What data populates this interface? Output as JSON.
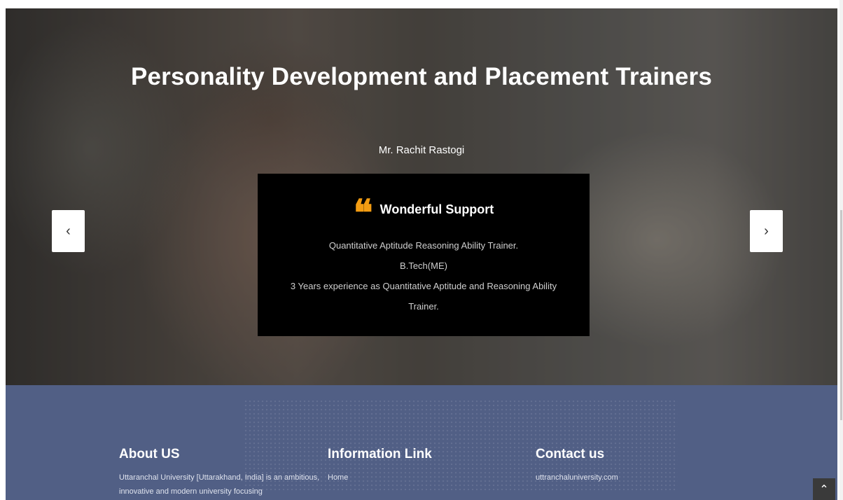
{
  "hero": {
    "title": "Personality Development and Placement Trainers",
    "trainer_name": "Mr. Rachit Rastogi",
    "quote_icon": "❝",
    "quote_heading": "Wonderful Support",
    "lines": [
      "Quantitative Aptitude Reasoning Ability Trainer.",
      "B.Tech(ME)",
      "3 Years experience as Quantitative Aptitude and Reasoning Ability Trainer."
    ],
    "prev_symbol": "‹",
    "next_symbol": "›"
  },
  "footer": {
    "about": {
      "heading": "About US",
      "text": "Uttaranchal University [Uttarakhand, India] is an ambitious, innovative and modern university focusing"
    },
    "info": {
      "heading": "Information Link",
      "links": [
        "Home"
      ]
    },
    "contact": {
      "heading": "Contact us",
      "website": "uttranchaluniversity.com"
    }
  },
  "scroll_top_symbol": "⌃",
  "colors": {
    "accent": "#f39c12",
    "footer_bg": "#515f85",
    "card_bg": "#000000"
  }
}
